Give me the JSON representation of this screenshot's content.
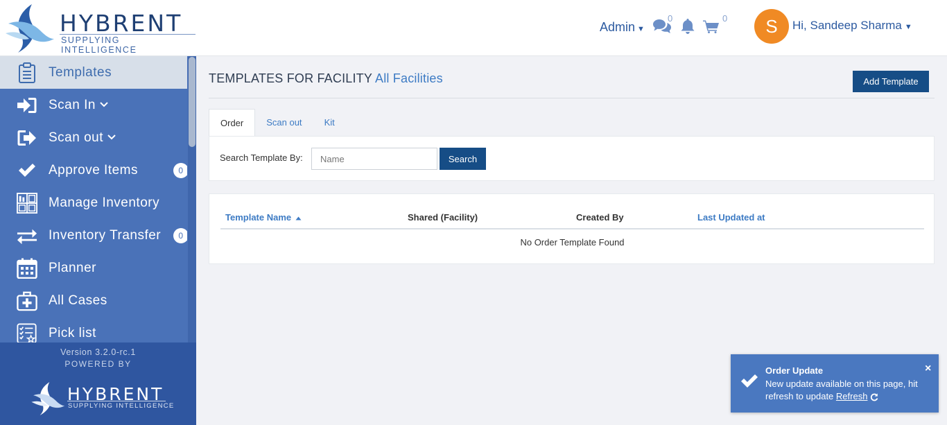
{
  "header": {
    "logo_name": "HYBRENT",
    "logo_tagline": "SUPPLYING INTELLIGENCE",
    "admin_label": "Admin",
    "messages_count": "0",
    "cart_count": "0",
    "avatar_initial": "S",
    "user_greeting": "Hi, Sandeep Sharma"
  },
  "sidebar": {
    "items": [
      {
        "label": "Templates",
        "icon": "clipboard-icon",
        "active": true
      },
      {
        "label": "Scan In",
        "icon": "sign-in-icon",
        "has_submenu": true
      },
      {
        "label": "Scan out",
        "icon": "sign-out-icon",
        "has_submenu": true
      },
      {
        "label": "Approve Items",
        "icon": "check-icon",
        "badge": "0"
      },
      {
        "label": "Manage Inventory",
        "icon": "inventory-grid-icon"
      },
      {
        "label": "Inventory Transfer",
        "icon": "transfer-arrows-icon",
        "badge": "0"
      },
      {
        "label": "Planner",
        "icon": "calendar-icon"
      },
      {
        "label": "All Cases",
        "icon": "medical-case-icon"
      },
      {
        "label": "Pick list",
        "icon": "checklist-icon"
      }
    ],
    "version": "Version 3.2.0-rc.1",
    "powered_by": "POWERED BY",
    "footer_logo_name": "HYBRENT",
    "footer_logo_tagline": "SUPPLYING INTELLIGENCE"
  },
  "main": {
    "title_prefix": "TEMPLATES FOR FACILITY",
    "facility": "All Facilities",
    "add_template_label": "Add Template",
    "tabs": [
      {
        "label": "Order",
        "active": true
      },
      {
        "label": "Scan out"
      },
      {
        "label": "Kit"
      }
    ],
    "search": {
      "label": "Search Template By:",
      "placeholder": "Name",
      "value": "",
      "button_label": "Search"
    },
    "table": {
      "columns": [
        {
          "label": "Template Name",
          "sortable": true,
          "sort": "asc"
        },
        {
          "label": "Shared (Facility)",
          "sortable": false
        },
        {
          "label": "Created By",
          "sortable": false
        },
        {
          "label": "Last Updated at",
          "sortable": true
        }
      ],
      "rows": [],
      "empty_message": "No Order Template Found"
    }
  },
  "toast": {
    "title": "Order Update",
    "message": "New update available on this page, hit refresh to update",
    "link_label": "Refresh",
    "close_label": "×"
  },
  "colors": {
    "primary": "#164d86",
    "sidebar": "#4a72b8",
    "link": "#3d7bc4",
    "avatar": "#f08a24",
    "toast": "#4a78c0"
  }
}
